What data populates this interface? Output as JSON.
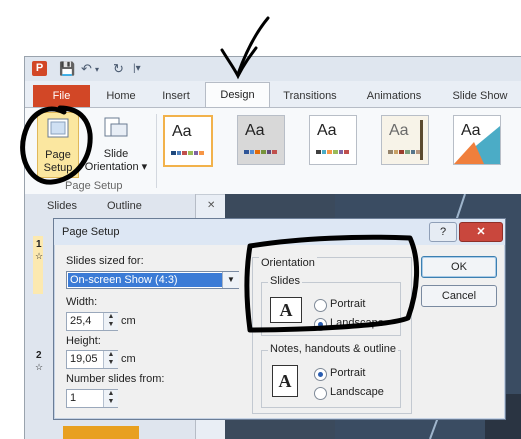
{
  "app": {
    "logo": "P",
    "qat_save": "💾",
    "qat_undo": "↶",
    "qat_undo_arrow": "▾",
    "qat_redo": "↻",
    "qat_more": "|▾"
  },
  "tabs": [
    {
      "label": "File"
    },
    {
      "label": "Home"
    },
    {
      "label": "Insert"
    },
    {
      "label": "Design"
    },
    {
      "label": "Transitions"
    },
    {
      "label": "Animations"
    },
    {
      "label": "Slide Show"
    }
  ],
  "ribbon": {
    "page_setup_line1": "Page",
    "page_setup_line2": "Setup",
    "slide_orientation_line1": "Slide",
    "slide_orientation_line2": "Orientation ▾",
    "group_label": "Page Setup",
    "theme_glyph": "Aa"
  },
  "left_pane": {
    "tab_slides": "Slides",
    "tab_outline": "Outline",
    "close": "✕",
    "slide1_num": "1",
    "slide1_star": "☆",
    "slide2_num": "2",
    "slide2_star": "☆"
  },
  "dialog": {
    "title": "Page Setup",
    "help": "?",
    "close": "✕",
    "slides_sized_for_label": "Slides sized for:",
    "slides_sized_for_value": "On-screen Show (4:3)",
    "width_label": "Width:",
    "width_value": "25,4",
    "width_unit": "cm",
    "height_label": "Height:",
    "height_value": "19,05",
    "height_unit": "cm",
    "number_from_label": "Number slides from:",
    "number_from_value": "1",
    "orientation_label": "Orientation",
    "slides_group_label": "Slides",
    "slides_portrait": "Portrait",
    "slides_landscape": "Landscape",
    "notes_group_label": "Notes, handouts & outline",
    "notes_portrait": "Portrait",
    "notes_landscape": "Landscape",
    "doc_glyph": "A",
    "ok": "OK",
    "cancel": "Cancel"
  },
  "colors": {
    "file_tab": "#d24726",
    "annotation": "#000000",
    "selected": "#3b7bd6"
  }
}
